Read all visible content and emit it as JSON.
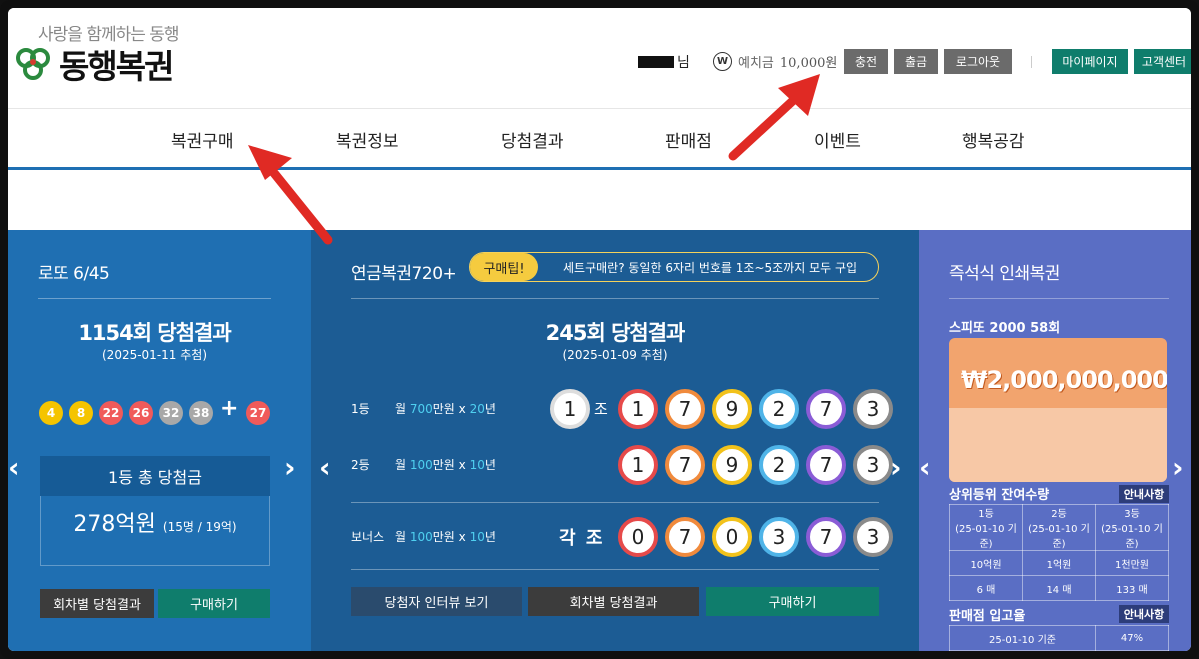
{
  "header": {
    "tagline": "사랑을 함께하는 동행",
    "logo_text": "동행복권",
    "user_suffix": "님",
    "deposit_icon": "W",
    "deposit_label": "예치금",
    "deposit_amount": "10,000원",
    "buttons": [
      "충전",
      "출금",
      "로그아웃"
    ],
    "right_buttons": [
      "마이페이지",
      "고객센터"
    ]
  },
  "nav": {
    "items": [
      "복권구매",
      "복권정보",
      "당첨결과",
      "판매점",
      "이벤트",
      "행복공감"
    ]
  },
  "lotto": {
    "title": "로또 6/45",
    "round_text": "1154회 당첨결과",
    "date": "(2025-01-11 추첨)",
    "balls": [
      "4",
      "8",
      "22",
      "26",
      "32",
      "38"
    ],
    "plus": "+",
    "bonus": "27",
    "prize_label": "1등 총 당첨금",
    "prize_amount": "278억원",
    "prize_detail": "(15명 / 19억)",
    "btn_history": "회차별 당첨결과",
    "btn_buy": "구매하기"
  },
  "pension": {
    "title": "연금복권720+",
    "tip_badge": "구매팁!",
    "tip_text": "세트구매란? 동일한 6자리 번호를 1조~5조까지 모두 구입",
    "round_text": "245회 당첨결과",
    "date": "(2025-01-09 추첨)",
    "rows": [
      {
        "rank": "1등",
        "pre": "월 ",
        "amount": "700",
        "mid": "만원 x ",
        "years": "20",
        "post": "년",
        "group": "1",
        "group_label": "조",
        "digits": [
          "1",
          "7",
          "9",
          "2",
          "7",
          "3"
        ]
      },
      {
        "rank": "2등",
        "pre": "월 ",
        "amount": "100",
        "mid": "만원 x ",
        "years": "10",
        "post": "년",
        "digits": [
          "1",
          "7",
          "9",
          "2",
          "7",
          "3"
        ]
      },
      {
        "rank": "보너스",
        "pre": "월 ",
        "amount": "100",
        "mid": "만원 x ",
        "years": "10",
        "post": "년",
        "group_label": "각 조",
        "digits": [
          "0",
          "7",
          "0",
          "3",
          "7",
          "3"
        ]
      }
    ],
    "btn_interview": "당첨자 인터뷰 보기",
    "btn_history": "회차별 당첨결과",
    "btn_buy": "구매하기"
  },
  "instant": {
    "title": "즉석식 인쇄복권",
    "product": "스피또 2000 58회",
    "ticket_amount": "₩2,000,000,000",
    "stock_title": "상위등위 잔여수량",
    "notice": "안내사항",
    "stock_headers": [
      [
        "1등",
        "(25-01-10 기준)"
      ],
      [
        "2등",
        "(25-01-10 기준)"
      ],
      [
        "3등",
        "(25-01-10 기준)"
      ]
    ],
    "stock_prizes": [
      "10억원",
      "1억원",
      "1천만원"
    ],
    "stock_counts": [
      "6 매",
      "14 매",
      "133 매"
    ],
    "store_title": "판매점 입고율",
    "store_notice": "안내사항",
    "store_date": "25-01-10 기준",
    "store_rate": "47%"
  },
  "colors": {
    "lotto_bg": "#1f6fb2",
    "pension_bg": "#1c5c94",
    "instant_bg": "#5a6ec4",
    "teal": "#0f7d6c",
    "nav_line": "#1e6fb3",
    "annotation_arrow": "#e02a24"
  }
}
